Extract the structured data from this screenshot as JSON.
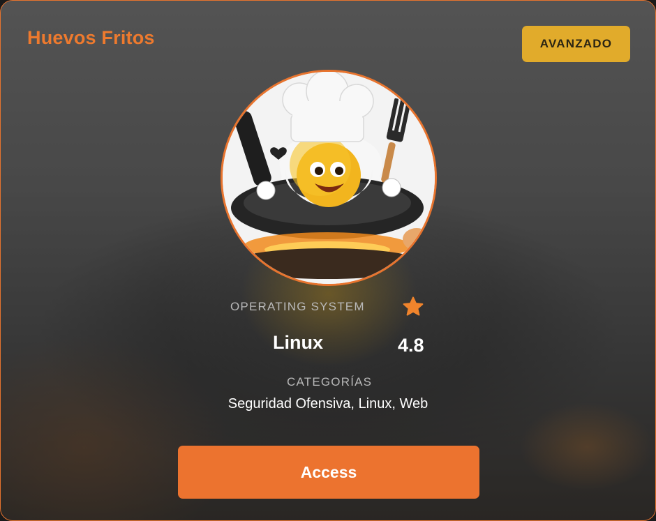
{
  "card": {
    "title": "Huevos Fritos",
    "level": "AVANZADO",
    "avatar_icon": "fried-egg-chef-icon",
    "os_label": "OPERATING SYSTEM",
    "os_value": "Linux",
    "rating_icon": "star-icon",
    "rating": "4.8",
    "categories_label": "CATEGORÍAS",
    "categories_value": "Seguridad Ofensiva, Linux, Web",
    "access_label": "Access"
  },
  "colors": {
    "accent": "#ec732f",
    "badge": "#e1ab2b",
    "star": "#f0842c"
  }
}
